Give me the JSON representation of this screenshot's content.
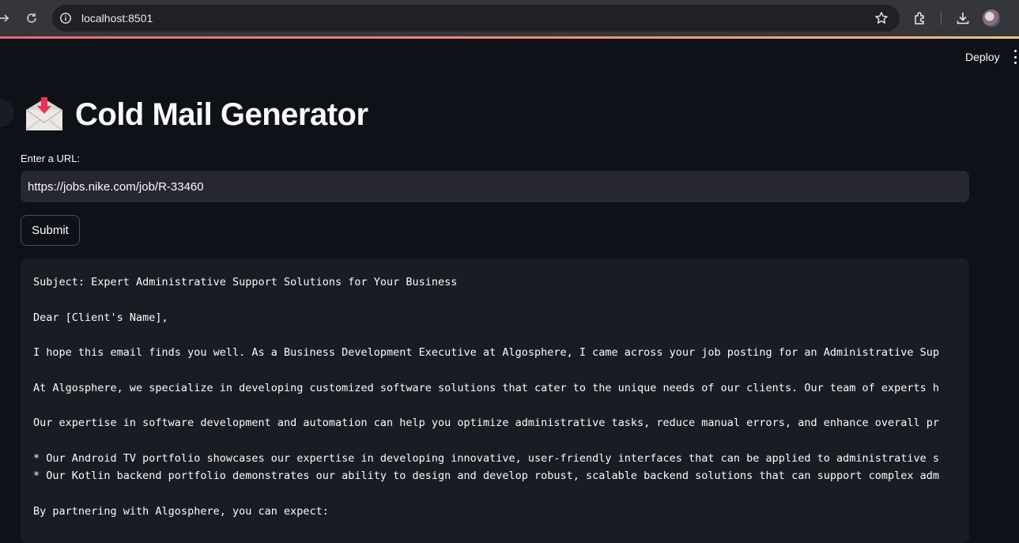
{
  "browser": {
    "url": "localhost:8501",
    "icons": [
      "forward-icon",
      "reload-icon",
      "site-info-icon",
      "bookmark-star-icon",
      "extensions-icon",
      "downloads-icon",
      "profile-avatar"
    ]
  },
  "app": {
    "deploy_label": "Deploy",
    "title": "Cold Mail Generator",
    "title_emoji": "envelope-with-arrow",
    "url_label": "Enter a URL:",
    "url_value": "https://jobs.nike.com/job/R-33460",
    "submit_label": "Submit",
    "email": {
      "subject": "Subject: Expert Administrative Support Solutions for Your Business",
      "greeting": "Dear [Client's Name],",
      "para1": "I hope this email finds you well. As a Business Development Executive at Algosphere, I came across your job posting for an Administrative Sup",
      "para2": "At Algosphere, we specialize in developing customized software solutions that cater to the unique needs of our clients. Our team of experts h",
      "para3": "Our expertise in software development and automation can help you optimize administrative tasks, reduce manual errors, and enhance overall pr",
      "bullet1": "* Our Android TV portfolio showcases our expertise in developing innovative, user-friendly interfaces that can be applied to administrative s",
      "bullet2": "* Our Kotlin backend portfolio demonstrates our ability to design and develop robust, scalable backend solutions that can support complex adm",
      "para4": "By partnering with Algosphere, you can expect:"
    }
  },
  "colors": {
    "background": "#0e1117",
    "input_bg": "#262730",
    "code_bg": "#1a1c24",
    "text": "#fafafa",
    "accent_strip": "#ef8e71"
  }
}
